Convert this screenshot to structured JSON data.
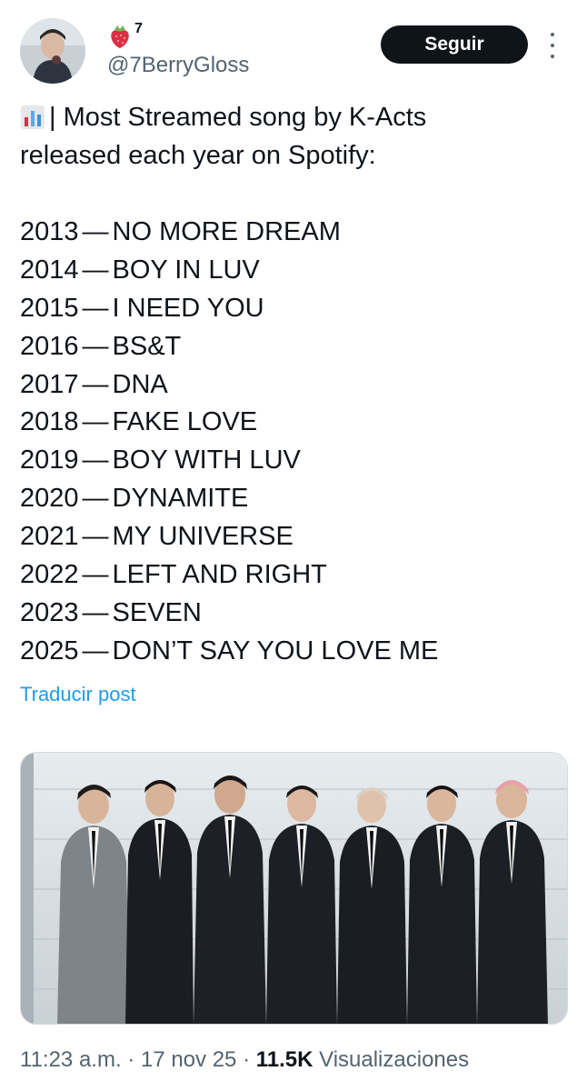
{
  "author": {
    "display_name_suffix": "7",
    "handle": "@7BerryGloss",
    "follow_label": "Seguir"
  },
  "post": {
    "intro_line1": "| Most Streamed song by K-Acts",
    "intro_line2": "released each year on Spotify:",
    "items": [
      {
        "year": "2013",
        "song": "NO MORE DREAM"
      },
      {
        "year": "2014",
        "song": "BOY IN LUV"
      },
      {
        "year": "2015",
        "song": "I NEED YOU"
      },
      {
        "year": "2016",
        "song": "BS&T"
      },
      {
        "year": "2017",
        "song": "DNA"
      },
      {
        "year": "2018",
        "song": "FAKE LOVE"
      },
      {
        "year": "2019",
        "song": "BOY WITH LUV"
      },
      {
        "year": "2020",
        "song": "DYNAMITE"
      },
      {
        "year": "2021",
        "song": "MY UNIVERSE"
      },
      {
        "year": "2022",
        "song": "LEFT AND RIGHT"
      },
      {
        "year": "2023",
        "song": "SEVEN"
      },
      {
        "year": "2025",
        "song": "DON’T SAY YOU LOVE ME"
      }
    ],
    "dash": "—",
    "translate_label": "Traducir post"
  },
  "meta": {
    "time": "11:23 a.m.",
    "sep": "·",
    "date": "17 nov 25",
    "views_count": "11.5K",
    "views_label": "Visualizaciones"
  },
  "icons": {
    "chart": "bar-chart-emoji",
    "berry": "strawberry-emoji",
    "more": "more-vertical-icon"
  },
  "colors": {
    "follow_bg": "#0f1419",
    "link": "#1d9bf0",
    "muted": "#536471"
  }
}
